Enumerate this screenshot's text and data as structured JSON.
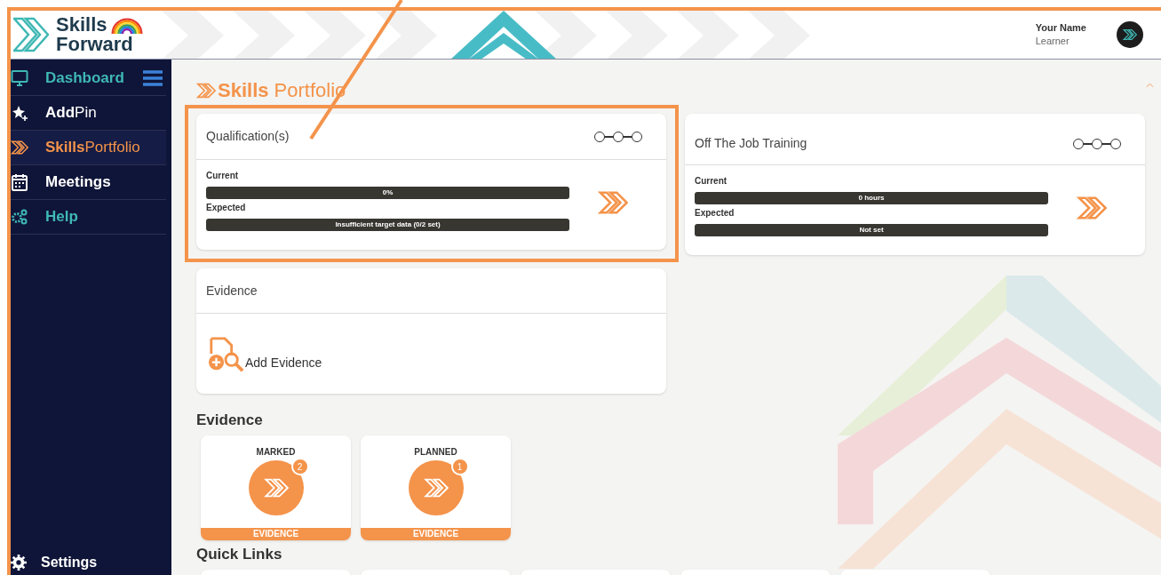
{
  "header": {
    "logo_line1": "Skills",
    "logo_line2": "Forward",
    "user_name": "Your Name",
    "user_role": "Learner"
  },
  "sidebar": {
    "items": [
      {
        "label": "Dashboard",
        "kind": "monitor",
        "color": "#3fb8b4",
        "selected": false
      },
      {
        "label": "**Add**Pin",
        "kind": "pin",
        "color": "#ffffff",
        "selected": false
      },
      {
        "label": "**Skills**Portfolio",
        "kind": "chevrons",
        "color": "#f4934a",
        "selected": true
      },
      {
        "label": "Meetings",
        "kind": "calendar",
        "color": "#ffffff",
        "selected": false
      },
      {
        "label": "Help",
        "kind": "gears",
        "color": "#3fb8b4",
        "selected": false
      }
    ],
    "footer_item": {
      "label": "Settings"
    }
  },
  "page_title": "**Skills** Portfolio",
  "cards": [
    {
      "title": "Qualification(s)",
      "highlighted": true,
      "bars": [
        {
          "label": "Current",
          "text": "0%"
        },
        {
          "label": "Expected",
          "text": "Insufficient target data (0/2 set)"
        }
      ]
    },
    {
      "title": "Off The Job Training",
      "highlighted": false,
      "bars": [
        {
          "label": "Current",
          "text": "0 hours"
        },
        {
          "label": "Expected",
          "text": "Not set"
        }
      ]
    }
  ],
  "evidence_card": {
    "title": "Evidence",
    "action": "Add Evidence"
  },
  "evidence_section": {
    "heading": "Evidence",
    "tiles": [
      {
        "label": "MARKED",
        "count": "2",
        "footer": "EVIDENCE"
      },
      {
        "label": "PLANNED",
        "count": "1",
        "footer": "EVIDENCE"
      }
    ]
  },
  "quick_links": {
    "heading": "Quick Links"
  }
}
